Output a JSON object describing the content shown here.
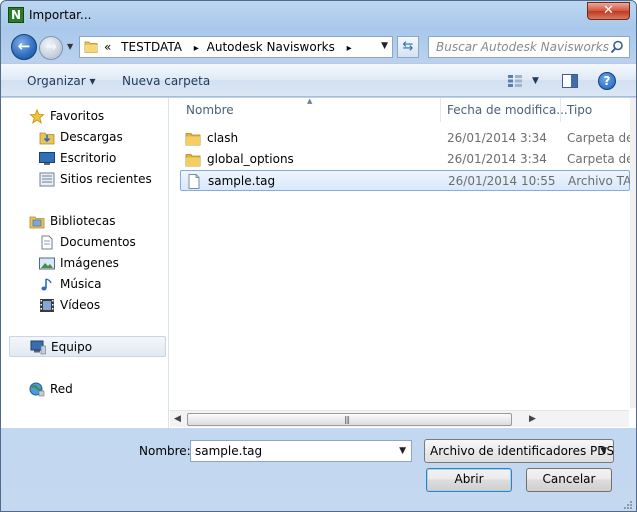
{
  "window": {
    "title": "Importar...",
    "app_icon_letter": "N",
    "close_glyph": "✕"
  },
  "nav": {
    "back_glyph": "←",
    "forward_glyph": "→",
    "address": {
      "overflow": "«",
      "segments": [
        "TESTDATA",
        "Autodesk Navisworks"
      ],
      "separator": "▸"
    },
    "search_placeholder": "Buscar Autodesk Navisworks"
  },
  "toolbar": {
    "organize_label": "Organizar ▾",
    "new_folder_label": "Nueva carpeta",
    "help_glyph": "?"
  },
  "sidebar": {
    "groups": [
      {
        "label": "Favoritos",
        "icon": "star-icon",
        "children": [
          {
            "label": "Descargas",
            "icon": "downloads-folder-icon"
          },
          {
            "label": "Escritorio",
            "icon": "desktop-icon"
          },
          {
            "label": "Sitios recientes",
            "icon": "recent-places-icon"
          }
        ]
      },
      {
        "label": "Bibliotecas",
        "icon": "libraries-icon",
        "children": [
          {
            "label": "Documentos",
            "icon": "documents-icon"
          },
          {
            "label": "Imágenes",
            "icon": "pictures-icon"
          },
          {
            "label": "Música",
            "icon": "music-icon"
          },
          {
            "label": "Vídeos",
            "icon": "videos-icon"
          }
        ]
      },
      {
        "label": "Equipo",
        "icon": "computer-icon",
        "selected": true,
        "children": []
      },
      {
        "label": "Red",
        "icon": "network-icon",
        "children": []
      }
    ]
  },
  "files": {
    "columns": [
      "Nombre",
      "Fecha de modifica...",
      "Tipo"
    ],
    "rows": [
      {
        "name": "clash",
        "date": "26/01/2014 3:34",
        "type": "Carpeta de a",
        "icon": "folder-icon",
        "selected": false
      },
      {
        "name": "global_options",
        "date": "26/01/2014 3:34",
        "type": "Carpeta de a",
        "icon": "folder-icon",
        "selected": false
      },
      {
        "name": "sample.tag",
        "date": "26/01/2014 10:55",
        "type": "Archivo TAG",
        "icon": "file-icon",
        "selected": true
      }
    ]
  },
  "footer": {
    "name_label": "Nombre:",
    "name_value": "sample.tag",
    "type_value": "Archivo de identificadores PDS",
    "open_label": "Abrir",
    "cancel_label": "Cancelar"
  }
}
